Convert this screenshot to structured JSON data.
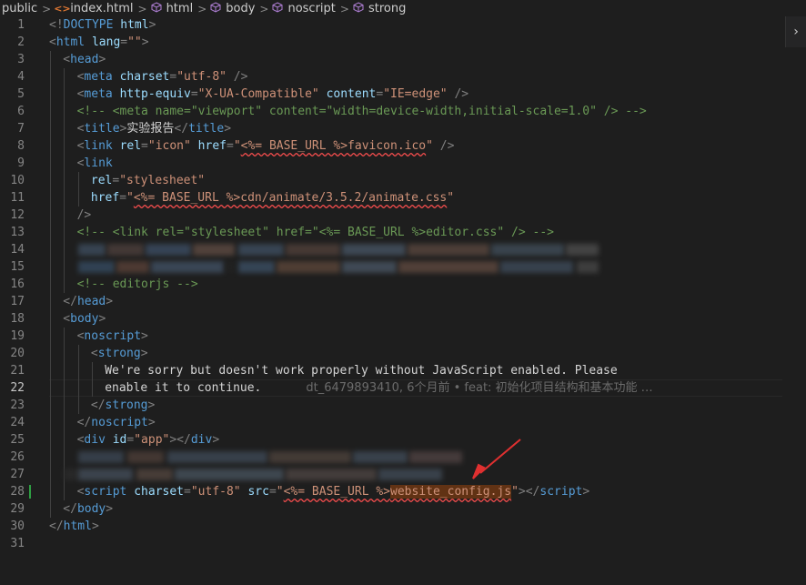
{
  "breadcrumb": {
    "items": [
      {
        "label": "public",
        "icon": "none"
      },
      {
        "label": "index.html",
        "icon": "html-file-icon"
      },
      {
        "label": "html",
        "icon": "cube-icon"
      },
      {
        "label": "body",
        "icon": "cube-icon"
      },
      {
        "label": "noscript",
        "icon": "cube-icon"
      },
      {
        "label": "strong",
        "icon": "cube-icon"
      }
    ]
  },
  "editor": {
    "current_line": 22,
    "modified_line": 28,
    "lines": [
      {
        "n": "1",
        "indent": 0,
        "tokens": [
          [
            "punc",
            "<!"
          ],
          [
            "tag",
            "DOCTYPE "
          ],
          [
            "attr",
            "html"
          ],
          [
            "punc",
            ">"
          ]
        ]
      },
      {
        "n": "2",
        "indent": 0,
        "tokens": [
          [
            "punc",
            "<"
          ],
          [
            "tag",
            "html "
          ],
          [
            "attr",
            "lang"
          ],
          [
            "punc",
            "="
          ],
          [
            "str",
            "\"\""
          ],
          [
            "punc",
            ">"
          ]
        ]
      },
      {
        "n": "3",
        "indent": 1,
        "tokens": [
          [
            "punc",
            "<"
          ],
          [
            "tag",
            "head"
          ],
          [
            "punc",
            ">"
          ]
        ]
      },
      {
        "n": "4",
        "indent": 2,
        "tokens": [
          [
            "punc",
            "<"
          ],
          [
            "tag",
            "meta "
          ],
          [
            "attr",
            "charset"
          ],
          [
            "punc",
            "="
          ],
          [
            "str",
            "\"utf-8\""
          ],
          [
            "punc",
            " />"
          ]
        ]
      },
      {
        "n": "5",
        "indent": 2,
        "tokens": [
          [
            "punc",
            "<"
          ],
          [
            "tag",
            "meta "
          ],
          [
            "attr",
            "http-equiv"
          ],
          [
            "punc",
            "="
          ],
          [
            "str",
            "\"X-UA-Compatible\""
          ],
          [
            "text",
            " "
          ],
          [
            "attr",
            "content"
          ],
          [
            "punc",
            "="
          ],
          [
            "str",
            "\"IE=edge\""
          ],
          [
            "punc",
            " />"
          ]
        ]
      },
      {
        "n": "6",
        "indent": 2,
        "tokens": [
          [
            "com",
            "<!-- <meta name=\"viewport\" content=\"width=device-width,initial-scale=1.0\" /> -->"
          ]
        ]
      },
      {
        "n": "7",
        "indent": 2,
        "tokens": [
          [
            "punc",
            "<"
          ],
          [
            "tag",
            "title"
          ],
          [
            "punc",
            ">"
          ],
          [
            "text",
            "实验报告"
          ],
          [
            "punc",
            "</"
          ],
          [
            "tag",
            "title"
          ],
          [
            "punc",
            ">"
          ]
        ]
      },
      {
        "n": "8",
        "indent": 2,
        "tokens": [
          [
            "punc",
            "<"
          ],
          [
            "tag",
            "link "
          ],
          [
            "attr",
            "rel"
          ],
          [
            "punc",
            "="
          ],
          [
            "str",
            "\"icon\""
          ],
          [
            "text",
            " "
          ],
          [
            "attr",
            "href"
          ],
          [
            "punc",
            "="
          ],
          [
            "str",
            "\""
          ],
          [
            "err",
            "<%= BASE_URL %>favicon.ico"
          ],
          [
            "str",
            "\""
          ],
          [
            "punc",
            " />"
          ]
        ]
      },
      {
        "n": "9",
        "indent": 2,
        "tokens": [
          [
            "punc",
            "<"
          ],
          [
            "tag",
            "link"
          ]
        ]
      },
      {
        "n": "10",
        "indent": 3,
        "tokens": [
          [
            "attr",
            "rel"
          ],
          [
            "punc",
            "="
          ],
          [
            "str",
            "\"stylesheet\""
          ]
        ]
      },
      {
        "n": "11",
        "indent": 3,
        "tokens": [
          [
            "attr",
            "href"
          ],
          [
            "punc",
            "="
          ],
          [
            "str",
            "\""
          ],
          [
            "err",
            "<%= BASE_URL %>cdn/animate/3.5.2/animate.css"
          ],
          [
            "str",
            "\""
          ]
        ]
      },
      {
        "n": "12",
        "indent": 2,
        "tokens": [
          [
            "punc",
            "/>"
          ]
        ]
      },
      {
        "n": "13",
        "indent": 2,
        "tokens": [
          [
            "com",
            "<!-- <link rel=\"stylesheet\" href=\"<%= BASE_URL %>editor.css\" /> -->"
          ]
        ]
      },
      {
        "n": "14",
        "indent": 2,
        "tokens": [],
        "blurred": "a"
      },
      {
        "n": "15",
        "indent": 2,
        "tokens": [],
        "blurred": "b"
      },
      {
        "n": "16",
        "indent": 2,
        "tokens": [
          [
            "com",
            "<!-- editorjs -->"
          ]
        ]
      },
      {
        "n": "17",
        "indent": 1,
        "tokens": [
          [
            "punc",
            "</"
          ],
          [
            "tag",
            "head"
          ],
          [
            "punc",
            ">"
          ]
        ]
      },
      {
        "n": "18",
        "indent": 1,
        "tokens": [
          [
            "punc",
            "<"
          ],
          [
            "tag",
            "body"
          ],
          [
            "punc",
            ">"
          ]
        ]
      },
      {
        "n": "19",
        "indent": 2,
        "tokens": [
          [
            "punc",
            "<"
          ],
          [
            "tag",
            "noscript"
          ],
          [
            "punc",
            ">"
          ]
        ]
      },
      {
        "n": "20",
        "indent": 3,
        "tokens": [
          [
            "punc",
            "<"
          ],
          [
            "tag",
            "strong"
          ],
          [
            "punc",
            ">"
          ]
        ]
      },
      {
        "n": "21",
        "indent": 4,
        "tokens": [
          [
            "text",
            "We're sorry but doesn't work properly without JavaScript enabled. Please"
          ]
        ]
      },
      {
        "n": "22",
        "indent": 4,
        "tokens": [
          [
            "text",
            "enable it to continue."
          ]
        ],
        "blame": "dt_6479893410, 6个月前 • feat: 初始化项目结构和基本功能 …"
      },
      {
        "n": "23",
        "indent": 3,
        "tokens": [
          [
            "punc",
            "</"
          ],
          [
            "tag",
            "strong"
          ],
          [
            "punc",
            ">"
          ]
        ]
      },
      {
        "n": "24",
        "indent": 2,
        "tokens": [
          [
            "punc",
            "</"
          ],
          [
            "tag",
            "noscript"
          ],
          [
            "punc",
            ">"
          ]
        ]
      },
      {
        "n": "25",
        "indent": 2,
        "tokens": [
          [
            "punc",
            "<"
          ],
          [
            "tag",
            "div "
          ],
          [
            "attr",
            "id"
          ],
          [
            "punc",
            "="
          ],
          [
            "str",
            "\"app\""
          ],
          [
            "punc",
            "></"
          ],
          [
            "tag",
            "div"
          ],
          [
            "punc",
            ">"
          ]
        ]
      },
      {
        "n": "26",
        "indent": 2,
        "tokens": [],
        "blurred": "c"
      },
      {
        "n": "27",
        "indent": 2,
        "tokens": [],
        "blurred": "d"
      },
      {
        "n": "28",
        "indent": 2,
        "tokens": [
          [
            "punc",
            "<"
          ],
          [
            "tag",
            "script "
          ],
          [
            "attr",
            "charset"
          ],
          [
            "punc",
            "="
          ],
          [
            "str",
            "\"utf-8\""
          ],
          [
            "text",
            " "
          ],
          [
            "attr",
            "src"
          ],
          [
            "punc",
            "="
          ],
          [
            "str",
            "\""
          ],
          [
            "err",
            "<%= BASE_URL %>"
          ],
          [
            "hl",
            "website_config.js"
          ],
          [
            "str",
            "\""
          ],
          [
            "punc",
            "></"
          ],
          [
            "tag",
            "script"
          ],
          [
            "punc",
            ">"
          ]
        ]
      },
      {
        "n": "29",
        "indent": 1,
        "tokens": [
          [
            "punc",
            "</"
          ],
          [
            "tag",
            "body"
          ],
          [
            "punc",
            ">"
          ]
        ]
      },
      {
        "n": "30",
        "indent": 0,
        "tokens": [
          [
            "punc",
            "</"
          ],
          [
            "tag",
            "html"
          ],
          [
            "punc",
            ">"
          ]
        ]
      },
      {
        "n": "31",
        "indent": 0,
        "tokens": []
      }
    ]
  },
  "colors": {
    "background": "#1e1e1e",
    "tag": "#569cd6",
    "attr": "#9cdcfe",
    "string": "#ce9178",
    "comment": "#6a9955",
    "annotation_arrow": "#e03030"
  },
  "icons": {
    "sidebar_toggle": "chevron-right-icon"
  }
}
